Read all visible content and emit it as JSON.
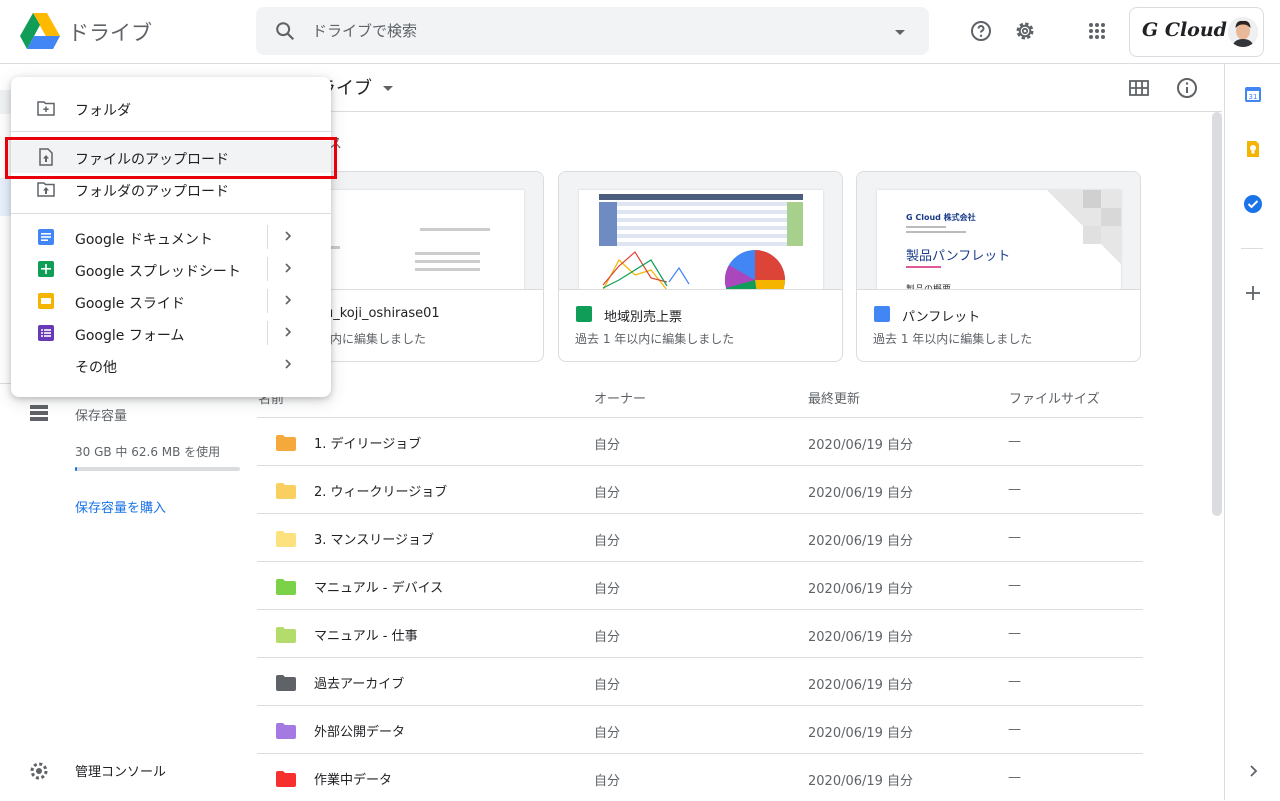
{
  "header": {
    "app_title": "ドライブ",
    "search_placeholder": "ドライブで検索",
    "account_brand": "G Cloud"
  },
  "main": {
    "breadcrumb": "ドライブ",
    "quick_access_title": "クセス",
    "cards": [
      {
        "name": "u_koji_oshirase01",
        "sub": "以内に編集しました",
        "type": "doc"
      },
      {
        "name": "地域別売上票",
        "sub": "過去 1 年以内に編集しました",
        "type": "sheet"
      },
      {
        "name": "パンフレット",
        "sub": "過去 1 年以内に編集しました",
        "type": "doc"
      }
    ],
    "card3_preview": {
      "company": "G Cloud 株式会社",
      "title": "製品パンフレット",
      "section": "製品の概要"
    },
    "table": {
      "headers": {
        "name": "名前",
        "owner": "オーナー",
        "modified": "最終更新",
        "size": "ファイルサイズ"
      },
      "rows": [
        {
          "name": "1. デイリージョブ",
          "owner": "自分",
          "modified": "2020/06/19 自分",
          "size": "—",
          "color": "#f6a93b"
        },
        {
          "name": "2. ウィークリージョブ",
          "owner": "自分",
          "modified": "2020/06/19 自分",
          "size": "—",
          "color": "#f9cf5f"
        },
        {
          "name": "3. マンスリージョブ",
          "owner": "自分",
          "modified": "2020/06/19 自分",
          "size": "—",
          "color": "#fbe27e"
        },
        {
          "name": "マニュアル - デバイス",
          "owner": "自分",
          "modified": "2020/06/19 自分",
          "size": "—",
          "color": "#7bd148"
        },
        {
          "name": "マニュアル - 仕事",
          "owner": "自分",
          "modified": "2020/06/19 自分",
          "size": "—",
          "color": "#b3dc6c"
        },
        {
          "name": "過去アーカイブ",
          "owner": "自分",
          "modified": "2020/06/19 自分",
          "size": "—",
          "color": "#5f6368"
        },
        {
          "name": "外部公開データ",
          "owner": "自分",
          "modified": "2020/06/19 自分",
          "size": "—",
          "color": "#a47ae2"
        },
        {
          "name": "作業中データ",
          "owner": "自分",
          "modified": "2020/06/19 自分",
          "size": "—",
          "color": "#f62f2f"
        }
      ]
    }
  },
  "sidebar": {
    "storage_label": "保存容量",
    "storage_usage": "30 GB 中 62.6 MB を使用",
    "storage_fraction": 0.002,
    "buy_storage": "保存容量を購入",
    "admin_console": "管理コンソール"
  },
  "menu": {
    "items": [
      {
        "label": "フォルダ",
        "icon": "folder-add-icon"
      },
      {
        "label": "ファイルのアップロード",
        "icon": "file-upload-icon"
      },
      {
        "label": "フォルダのアップロード",
        "icon": "folder-upload-icon"
      },
      {
        "label": "Google ドキュメント",
        "icon": "google-docs-icon",
        "color": "#4285f4"
      },
      {
        "label": "Google スプレッドシート",
        "icon": "google-sheets-icon",
        "color": "#0f9d58"
      },
      {
        "label": "Google スライド",
        "icon": "google-slides-icon",
        "color": "#f4b400"
      },
      {
        "label": "Google フォーム",
        "icon": "google-forms-icon",
        "color": "#673ab7"
      },
      {
        "label": "その他",
        "icon": ""
      }
    ]
  },
  "colors": {
    "accent": "#1a73e8",
    "highlight": "#e8000b"
  }
}
